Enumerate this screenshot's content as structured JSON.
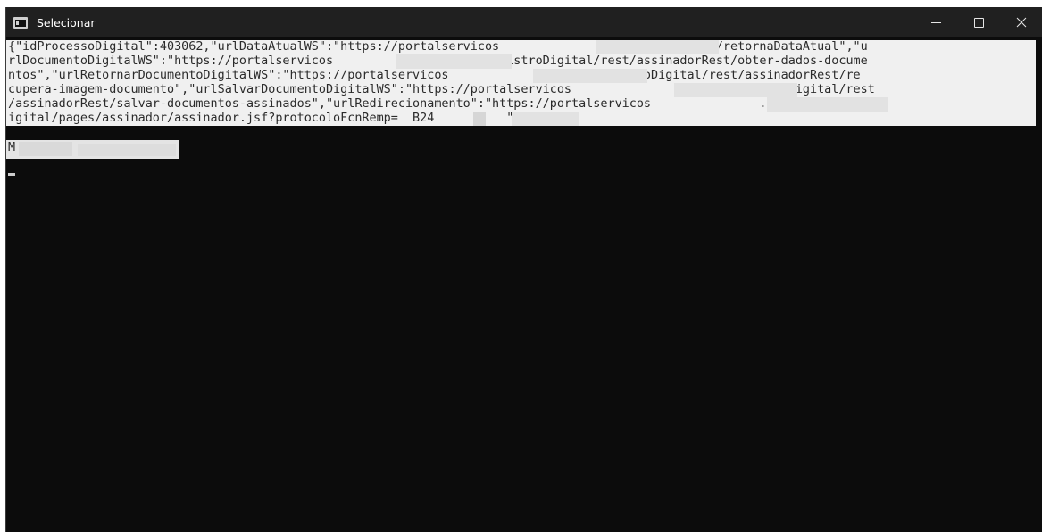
{
  "window": {
    "title": "Selecionar"
  },
  "console": {
    "lines": [
      "{\"idProcessoDigital\":403062,\"urlDataAtualWS\":\"https://portalservicos              gov.br/dataAtual/retornaDataAtual\",\"u",
      "rlDocumentoDigitalWS\":\"https://portalservicos             .gov.br/registroDigital/rest/assinadorRest/obter-dados-docume",
      "ntos\",\"urlRetornarDocumentoDigitalWS\":\"https://portalservicos             gov.br/registroDigital/rest/assinadorRest/re",
      "cupera-imagem-documento\",\"urlSalvarDocumentoDigitalWS\":\"https://portalservicos              .gov.br/registroDigital/rest",
      "/assinadorRest/salvar-documentos-assinados\",\"urlRedirecionamento\":\"https://portalservicos               .gov.br/registroD",
      "igital/pages/assinador/assinador.jsf?protocoloFcnRemp=  B24          \"}"
    ],
    "second_line_prefix": "M"
  },
  "colors": {
    "titlebar_bg": "#202020",
    "console_bg": "#0c0c0c",
    "selection_bg": "#f0f0f0",
    "redaction": "#e2e2e2"
  },
  "icons": {
    "app": "console-app-icon",
    "minimize": "minimize-icon",
    "maximize": "maximize-icon",
    "close": "close-icon"
  }
}
